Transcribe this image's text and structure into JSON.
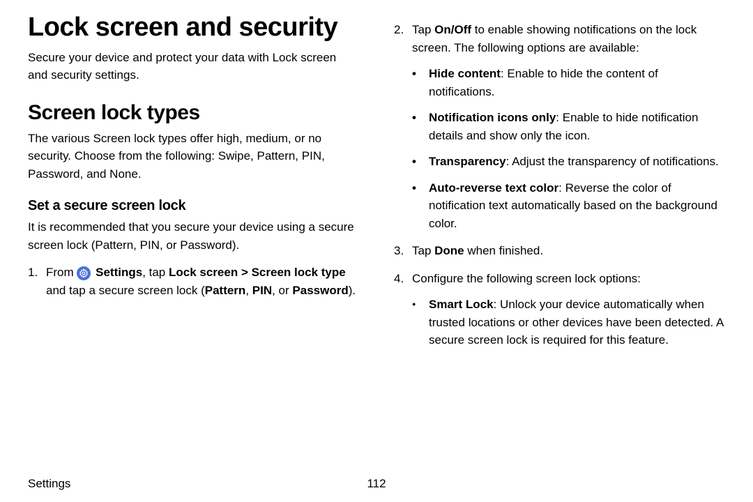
{
  "left": {
    "h1": "Lock screen and security",
    "intro": "Secure your device and protect your data with Lock screen and security settings.",
    "h2": "Screen lock types",
    "types_p": "The various Screen lock types offer high, medium, or no security. Choose from the following: Swipe, Pattern, PIN, Password, and None.",
    "h3": "Set a secure screen lock",
    "secure_p": "It is recommended that you secure your device using a secure screen lock (Pattern, PIN, or Password).",
    "step1": {
      "num": "1.",
      "pre": "From ",
      "settings": "Settings",
      "mid1": ", tap ",
      "path": "Lock screen > Screen lock type",
      "mid2": " and tap a secure screen lock (",
      "opts": "Pattern",
      "sep1": ", ",
      "opt2": "PIN",
      "sep2": ", or ",
      "opt3": "Password",
      "end": ")."
    }
  },
  "right": {
    "step2": {
      "num": "2.",
      "pre": "Tap ",
      "onoff": "On/Off",
      "rest": " to enable showing notifications on the lock screen. The following options are available:"
    },
    "opts": [
      {
        "b": "Hide content",
        "t": ": Enable to hide the content of notifications."
      },
      {
        "b": "Notification icons only",
        "t": ": Enable to hide notification details and show only the icon."
      },
      {
        "b": "Transparency",
        "t": ": Adjust the transparency of notifications."
      },
      {
        "b": "Auto-reverse text color",
        "t": ": Reverse the color of notification text automatically based on the background color."
      }
    ],
    "step3": {
      "num": "3.",
      "pre": "Tap ",
      "done": "Done",
      "rest": " when finished."
    },
    "step4": {
      "num": "4.",
      "text": "Configure the following screen lock options:"
    },
    "smart": {
      "b": "Smart Lock",
      "t": ": Unlock your device automatically when trusted locations or other devices have been detected. A secure screen lock is required for this feature."
    }
  },
  "footer": {
    "section": "Settings",
    "page": "112"
  }
}
